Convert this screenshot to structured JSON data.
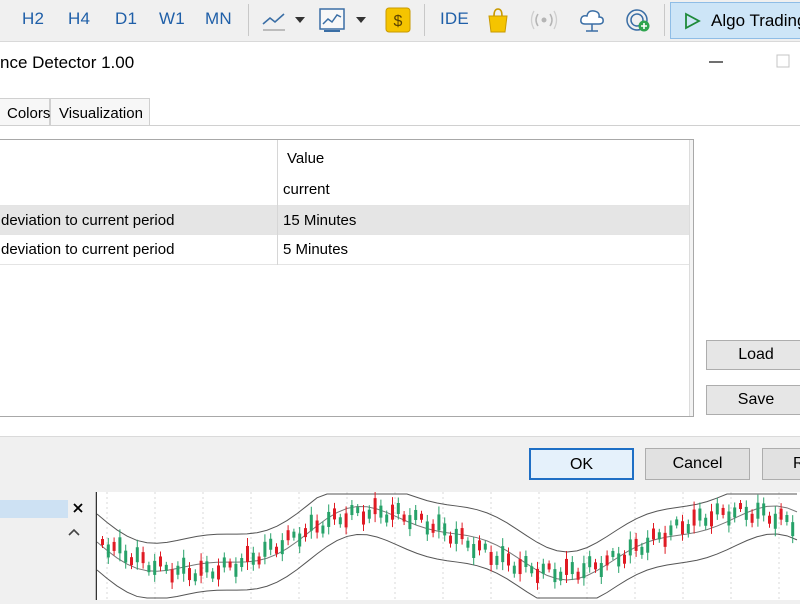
{
  "toolbar": {
    "timeframes": [
      "H2",
      "H4",
      "D1",
      "W1",
      "MN"
    ],
    "ide_label": "IDE",
    "algo_trading_label": "Algo Trading",
    "icons": [
      "line-chart-icon",
      "indicators-icon",
      "dollar-icon",
      "market-bag-icon",
      "signal-icon",
      "cloud-icon",
      "vps-icon",
      "play-icon"
    ]
  },
  "dialog": {
    "title": "nce Detector 1.00",
    "tabs": [
      "Colors",
      "Visualization"
    ],
    "grid": {
      "header_value": "Value",
      "rows": [
        {
          "name": "",
          "value": "current",
          "selected": false
        },
        {
          "name": "deviation to current period",
          "value": "15 Minutes",
          "selected": true
        },
        {
          "name": "deviation to current period",
          "value": "5 Minutes",
          "selected": false
        }
      ]
    },
    "side_buttons": {
      "load": "Load",
      "save": "Save"
    },
    "footer_buttons": {
      "ok": "OK",
      "cancel": "Cancel",
      "reset": "R"
    }
  },
  "colors": {
    "timeframe_text": "#1f5fa8",
    "algo_button_bg": "#cde5f7",
    "default_button_border": "#1f6fc5",
    "candle_up": "#26a269",
    "candle_down": "#e01b24"
  }
}
